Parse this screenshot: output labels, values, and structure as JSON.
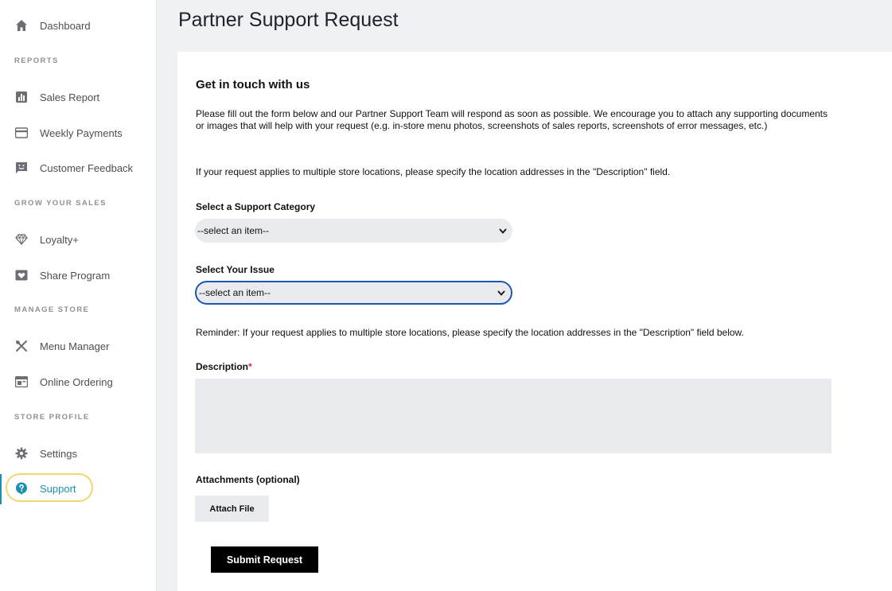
{
  "sidebar": {
    "dashboard": "Dashboard",
    "sections": {
      "reports": "REPORTS",
      "grow": "GROW YOUR SALES",
      "manage": "MANAGE STORE",
      "profile": "STORE PROFILE"
    },
    "items": {
      "sales_report": "Sales Report",
      "weekly_payments": "Weekly Payments",
      "customer_feedback": "Customer Feedback",
      "loyalty": "Loyalty+",
      "share_program": "Share Program",
      "menu_manager": "Menu Manager",
      "online_ordering": "Online Ordering",
      "settings": "Settings",
      "support": "Support"
    },
    "colors": {
      "active": "#1a8fb0",
      "icon": "#6b6f75",
      "highlight": "#f3d76a"
    }
  },
  "header": {
    "title": "Partner Support Request"
  },
  "form": {
    "heading": "Get in touch with us",
    "intro": "Please fill out the form below and our Partner Support Team will respond as soon as possible. We encourage you to attach any supporting documents or images that will help with your request (e.g. in-store menu photos, screenshots of sales reports, screenshots of error messages, etc.)",
    "multi_location_note": "If your request applies to multiple store locations, please specify the location addresses in the \"Description\" field.",
    "category_label": "Select a Support Category",
    "category_value": "--select an item--",
    "issue_label": "Select Your Issue",
    "issue_value": "--select an item--",
    "reminder": "Reminder: If your request applies to multiple store locations, please specify the location addresses in the \"Description\" field below.",
    "description_label": "Description",
    "required_mark": "*",
    "attachments_label": "Attachments (optional)",
    "attach_button": "Attach File",
    "submit_button": "Submit Request"
  }
}
